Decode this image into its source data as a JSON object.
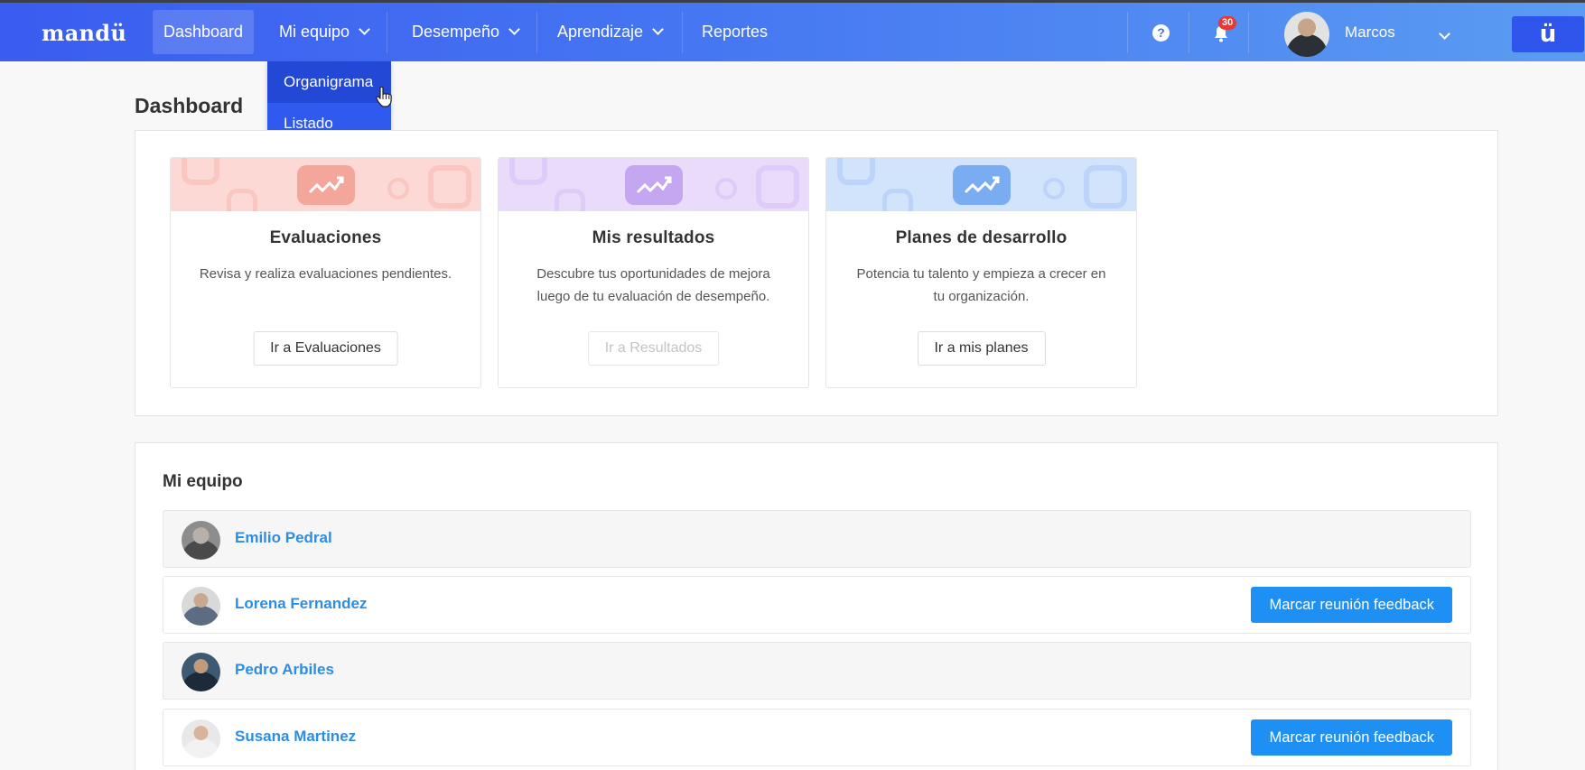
{
  "brand": {
    "logo_text": "mandü",
    "corner_badge": "ü"
  },
  "nav": {
    "items": [
      {
        "label": "Dashboard",
        "active": true
      },
      {
        "label": "Mi equipo",
        "has_dropdown": true
      },
      {
        "label": "Desempeño",
        "has_dropdown": true
      },
      {
        "label": "Aprendizaje",
        "has_dropdown": true
      },
      {
        "label": "Reportes"
      }
    ],
    "help_icon": "?",
    "notifications_count": "30",
    "user_name": "Marcos"
  },
  "dropdown": {
    "items": [
      {
        "label": "Organigrama",
        "hovered": true
      },
      {
        "label": "Listado"
      }
    ]
  },
  "page": {
    "title": "Dashboard",
    "cards": [
      {
        "title": "Evaluaciones",
        "description": "Revisa y realiza evaluaciones pendientes.",
        "button": "Ir a Evaluaciones",
        "button_disabled": false,
        "banner_color": "#fdd9d6",
        "box_color": "#f5a69b"
      },
      {
        "title": "Mis resultados",
        "description": "Descubre tus oportunidades de mejora luego de tu evaluación de desempeño.",
        "button": "Ir a Resultados",
        "button_disabled": true,
        "banner_color": "#e9dcfb",
        "box_color": "#c5a6f1"
      },
      {
        "title": "Planes de desarrollo",
        "description": "Potencia tu talento y empieza a crecer en tu organización.",
        "button": "Ir a mis planes",
        "button_disabled": false,
        "banner_color": "#d2e3fc",
        "box_color": "#79acf1"
      }
    ],
    "team": {
      "title": "Mi equipo",
      "members": [
        {
          "name": "Emilio Pedral",
          "feedback_button": null
        },
        {
          "name": "Lorena Fernandez",
          "feedback_button": "Marcar reunión feedback"
        },
        {
          "name": "Pedro Arbiles",
          "feedback_button": null
        },
        {
          "name": "Susana Martinez",
          "feedback_button": "Marcar reunión feedback"
        }
      ]
    }
  }
}
